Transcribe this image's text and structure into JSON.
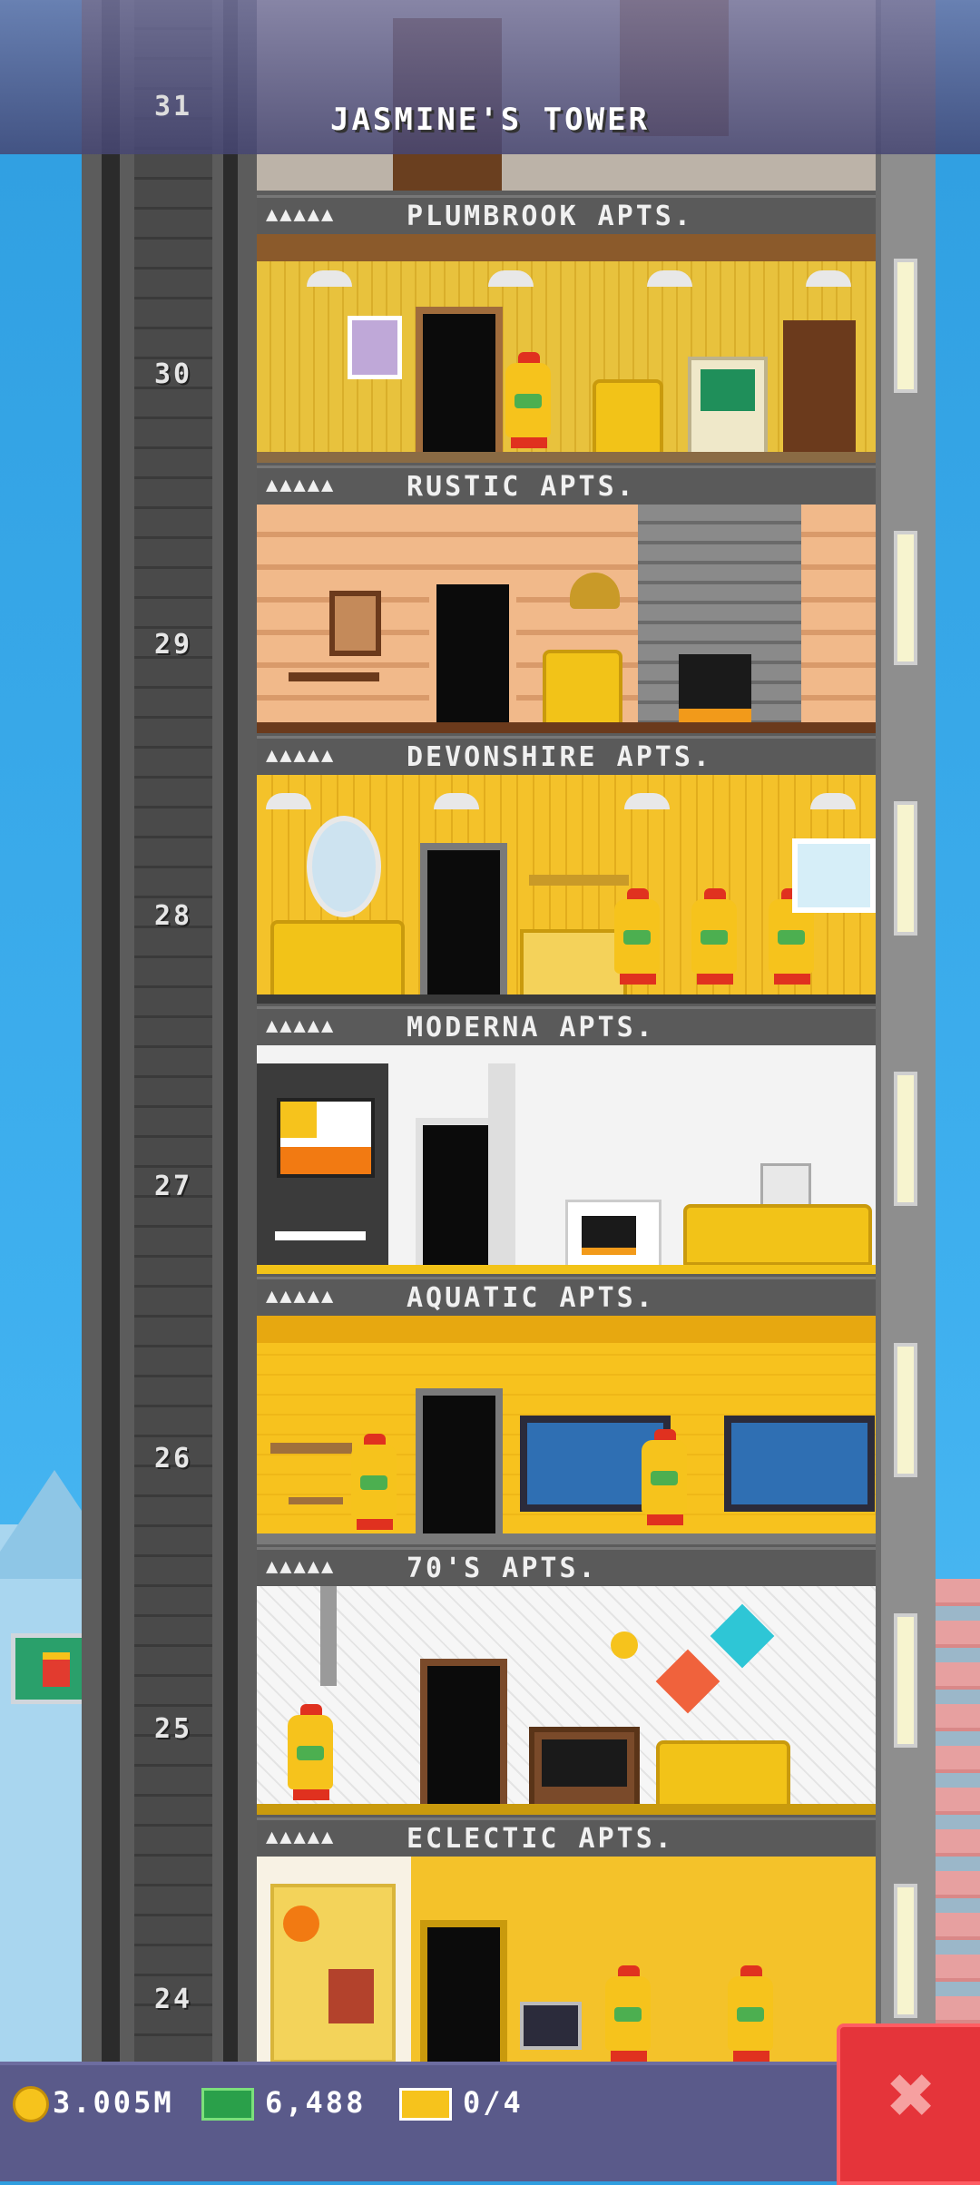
{
  "header": {
    "title": "JASMINE'S TOWER",
    "top_floor_number": "31"
  },
  "floors": [
    {
      "number": "30",
      "name": "PLUMBROOK APTS.",
      "stars": "▲▲▲▲▲"
    },
    {
      "number": "29",
      "name": "RUSTIC APTS.",
      "stars": "▲▲▲▲▲"
    },
    {
      "number": "28",
      "name": "DEVONSHIRE APTS.",
      "stars": "▲▲▲▲▲"
    },
    {
      "number": "27",
      "name": "MODERNA APTS.",
      "stars": "▲▲▲▲▲"
    },
    {
      "number": "26",
      "name": "AQUATIC APTS.",
      "stars": "▲▲▲▲▲"
    },
    {
      "number": "25",
      "name": "70'S APTS.",
      "stars": "▲▲▲▲▲"
    },
    {
      "number": "24",
      "name": "ECLECTIC APTS.",
      "stars": "▲▲▲▲▲"
    }
  ],
  "status": {
    "coins": "3.005M",
    "bux": "6,488",
    "tickets": "0/4"
  },
  "close_label": "✖",
  "colors": {
    "coin": "#f6c31c",
    "bux": "#2aa04a",
    "close": "#e5343a",
    "sky": "#3fb0ef"
  }
}
